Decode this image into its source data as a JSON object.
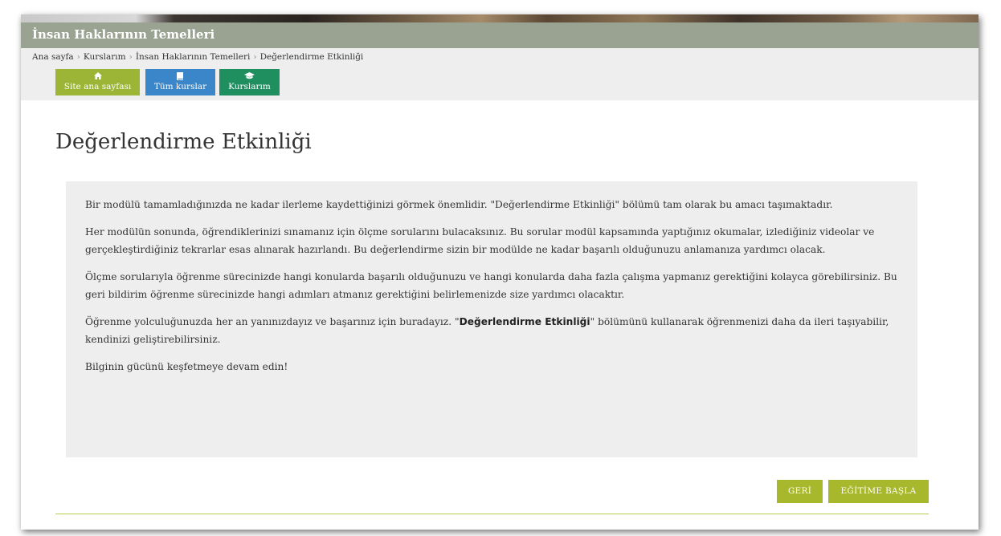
{
  "header": {
    "course_title": "İnsan Haklarının Temelleri"
  },
  "breadcrumb": {
    "items": [
      "Ana sayfa",
      "Kurslarım",
      "İnsan Haklarının Temelleri",
      "Değerlendirme Etkinliği"
    ],
    "separator": "›"
  },
  "nav": {
    "site_home": {
      "label": "Site ana sayfası",
      "icon": "home-icon"
    },
    "all_courses": {
      "label": "Tüm kurslar",
      "icon": "book-icon"
    },
    "my_courses": {
      "label": "Kurslarım",
      "icon": "graduation-cap-icon"
    }
  },
  "page": {
    "title": "Değerlendirme Etkinliği"
  },
  "content": {
    "p1": "Bir modülü tamamladığınızda ne kadar ilerleme kaydettiğinizi görmek önemlidir. \"Değerlendirme Etkinliği\" bölümü tam olarak bu amacı taşımaktadır.",
    "p2": "Her modülün sonunda, öğrendiklerinizi sınamanız için ölçme sorularını bulacaksınız. Bu sorular modül kapsamında yaptığınız okumalar, izlediğiniz videolar ve gerçekleştirdiğiniz tekrarlar esas alınarak hazırlandı. Bu değerlendirme sizin bir modülde ne kadar başarılı olduğunuzu anlamanıza yardımcı olacak.",
    "p3": "Ölçme sorularıyla öğrenme sürecinizde hangi konularda başarılı olduğunuzu ve hangi konularda daha fazla çalışma yapmanız gerektiğini kolayca görebilirsiniz. Bu geri bildirim öğrenme sürecinizde hangi adımları atmanız gerektiğini belirlemenizde size yardımcı olacaktır.",
    "p4_before": "Öğrenme yolculuğunuzda her an yanınızdayız ve başarınız için buradayız. \"",
    "p4_bold": "Değerlendirme Etkinliği",
    "p4_after": "\" bölümünü kullanarak öğrenmenizi daha da ileri taşıyabilir, kendinizi geliştirebilirsiniz.",
    "p5": "Bilginin gücünü keşfetmeye devam edin!"
  },
  "actions": {
    "back_label": "GERİ",
    "start_label": "EĞİTİME BAŞLA"
  },
  "colors": {
    "title_bar": "#9aa292",
    "btn_home": "#9cb536",
    "btn_all": "#3a86c8",
    "btn_mine": "#1f8f5f",
    "action": "#a7b82c"
  }
}
